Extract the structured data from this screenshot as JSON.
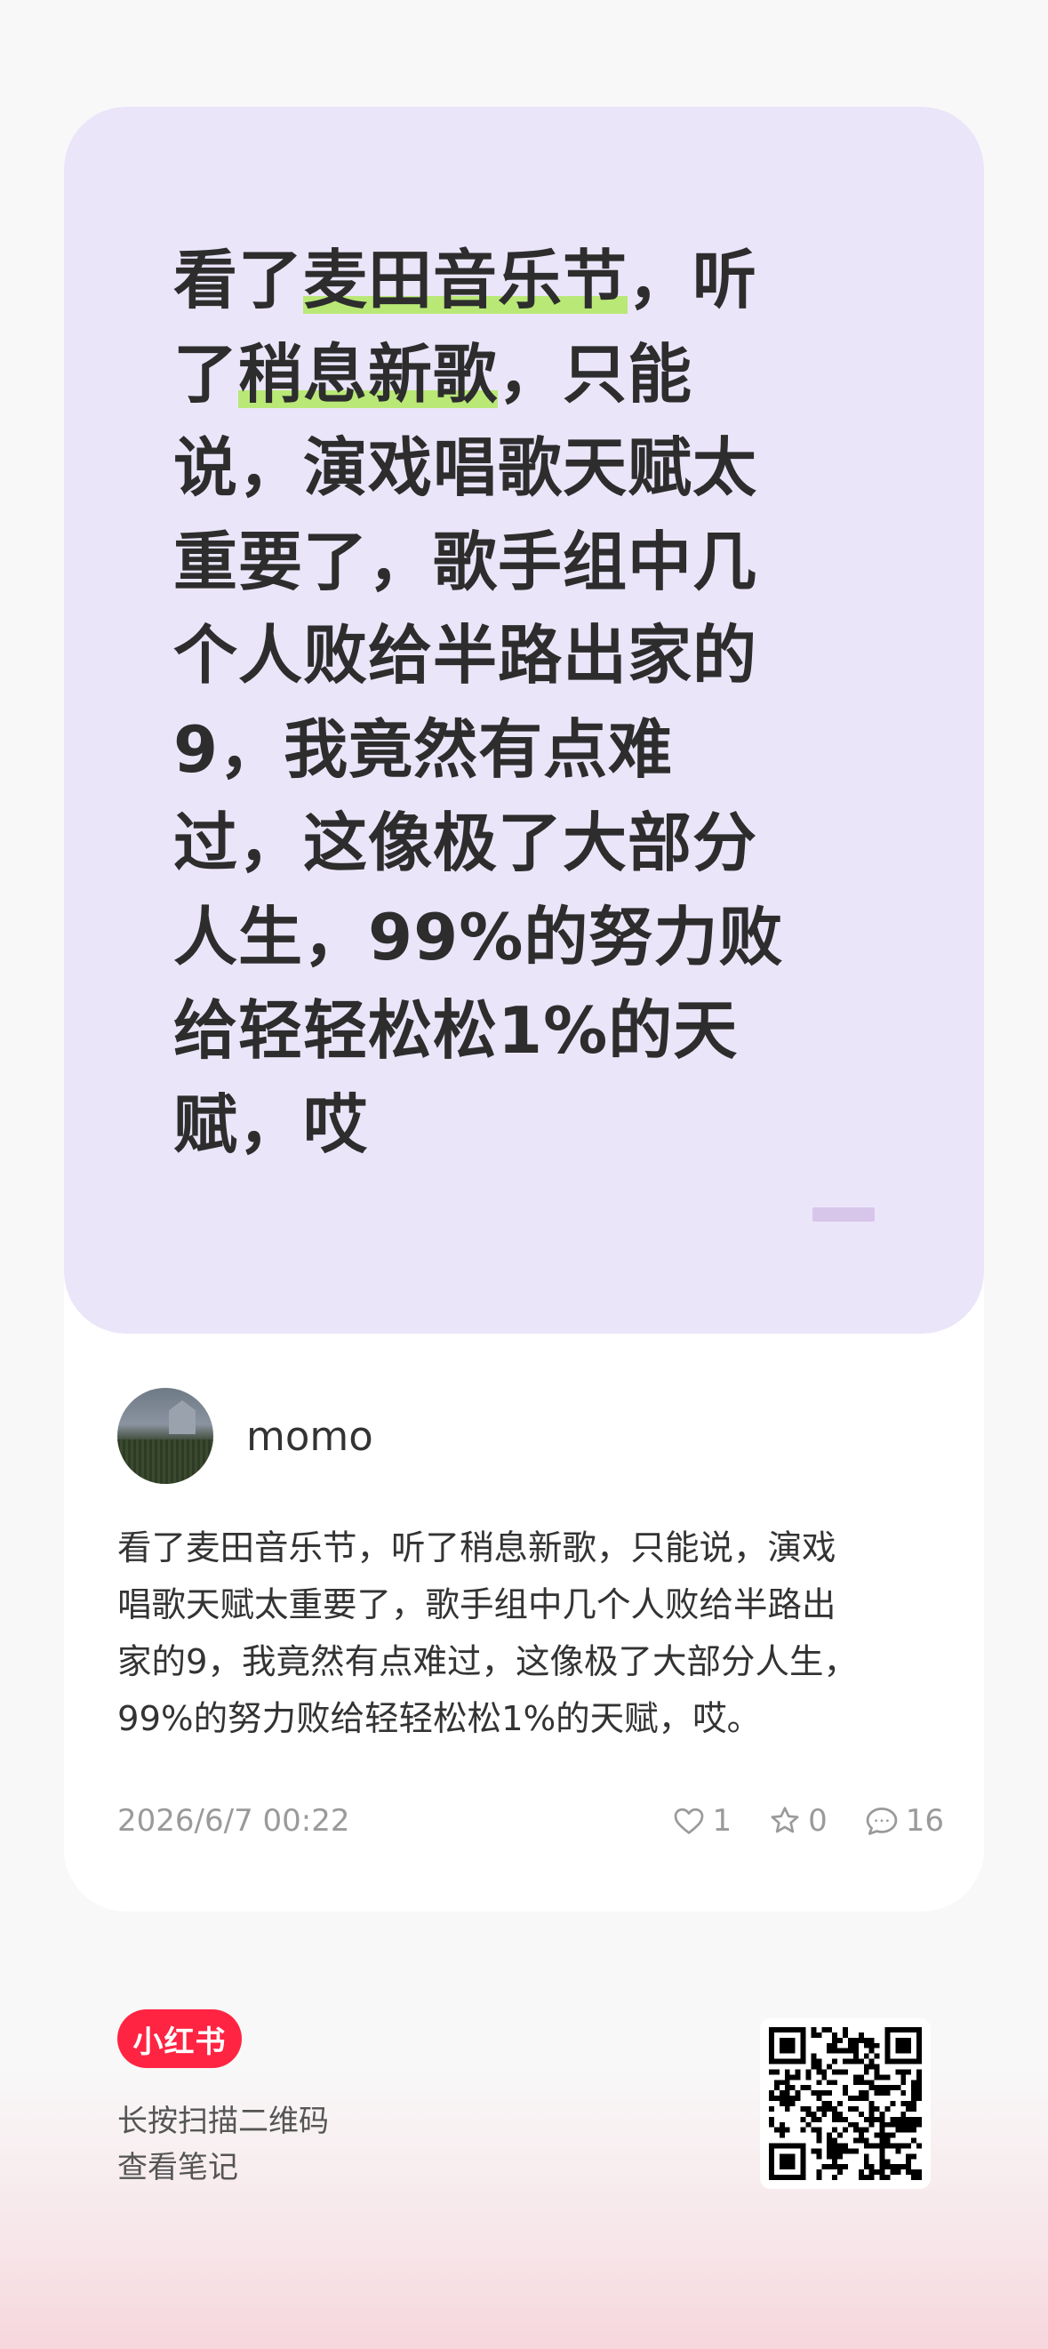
{
  "cover": {
    "lines": [
      {
        "before": "看了",
        "highlight": "麦田音乐节",
        "after": "，听"
      },
      {
        "before": "了",
        "highlight": "稍息新歌",
        "after": "，只能"
      },
      {
        "before": "说，演戏唱歌天赋太",
        "highlight": "",
        "after": ""
      },
      {
        "before": "重要了，歌手组中几",
        "highlight": "",
        "after": ""
      },
      {
        "before": "个人败给半路出家的",
        "highlight": "",
        "after": ""
      },
      {
        "before": "9，我竟然有点难",
        "highlight": "",
        "after": ""
      },
      {
        "before": "过，这像极了大部分",
        "highlight": "",
        "after": ""
      },
      {
        "before": "人生，99%的努力败",
        "highlight": "",
        "after": ""
      },
      {
        "before": "给轻轻松松1%的天",
        "highlight": "",
        "after": ""
      },
      {
        "before": "赋，哎",
        "highlight": "",
        "after": ""
      }
    ],
    "highlight_color": "#b9e877",
    "background_color": "#ebe5f9"
  },
  "author": {
    "name": "momo"
  },
  "post": {
    "body_lines": [
      "看了麦田音乐节，听了稍息新歌，只能说，演戏",
      "唱歌天赋太重要了，歌手组中几个人败给半路出",
      "家的9，我竟然有点难过，这像极了大部分人生，",
      "99%的努力败给轻轻松松1%的天赋，哎。"
    ],
    "timestamp": "2026/6/7 00:22",
    "likes": "1",
    "favorites": "0",
    "comments": "16"
  },
  "footer": {
    "brand": "小红书",
    "brand_color": "#ff2442",
    "scan_line1": "长按扫描二维码",
    "scan_line2": "查看笔记"
  }
}
